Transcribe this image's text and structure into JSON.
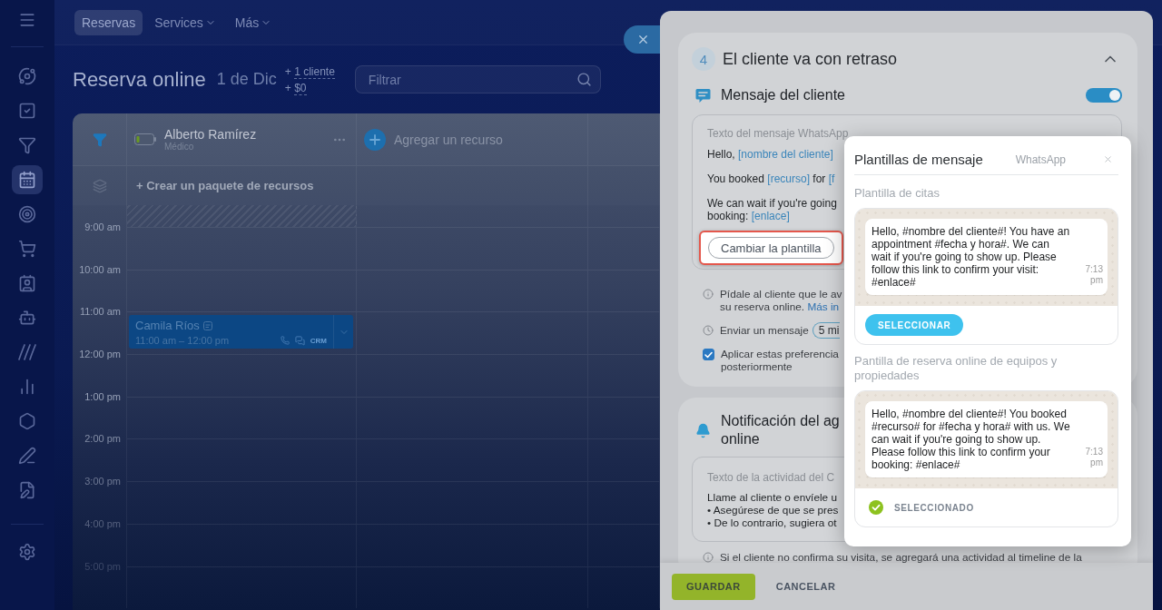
{
  "sidebar": {
    "items": [
      {
        "selected": false
      },
      {
        "selected": false
      },
      {
        "selected": false
      },
      {
        "selected": true
      },
      {
        "selected": false
      },
      {
        "selected": false
      },
      {
        "selected": false
      },
      {
        "selected": false
      },
      {
        "selected": false
      },
      {
        "selected": false
      },
      {
        "selected": false
      },
      {
        "selected": false
      },
      {
        "selected": false
      },
      {
        "selected": false
      }
    ]
  },
  "top_nav": {
    "tabs": [
      {
        "label": "Reservas",
        "selected": true,
        "dropdown": false
      },
      {
        "label": "Services",
        "selected": false,
        "dropdown": true
      },
      {
        "label": "Más",
        "selected": false,
        "dropdown": true
      }
    ]
  },
  "header": {
    "title": "Reserva online",
    "date": "1 de Dic",
    "stats": [
      {
        "sign": "+",
        "value": "1 cliente"
      },
      {
        "sign": "+",
        "value": "$0"
      }
    ],
    "search": {
      "placeholder": "Filtrar"
    }
  },
  "calendar": {
    "resource": {
      "name": "Alberto Ramírez",
      "role": "Médico"
    },
    "add_resource": "Agregar un recurso",
    "create_package": "+ Crear un paquete de recursos",
    "hours": [
      {
        "label": "9:00 am"
      },
      {
        "label": "10:00 am"
      },
      {
        "label": "11:00 am",
        "bookings": [
          {
            "name": "Camila Ríos",
            "time": "11:00 am – 12:00 pm",
            "tag": "CRM"
          }
        ]
      },
      {
        "label": "12:00 pm"
      },
      {
        "label": "1:00 pm"
      },
      {
        "label": "2:00 pm"
      },
      {
        "label": "3:00 pm"
      },
      {
        "label": "4:00 pm"
      },
      {
        "label": "5:00 pm"
      }
    ]
  },
  "panel": {
    "step": {
      "number": "4",
      "title": "El cliente va con retraso",
      "expanded": true
    },
    "client_message": {
      "title": "Mensaje del cliente",
      "enabled": true,
      "message_box": {
        "label": "Texto del mensaje WhatsApp",
        "paragraphs": [
          {
            "lines": [
              {
                "segments": [
                  {
                    "kind": "plain",
                    "text": "Hello, "
                  },
                  {
                    "kind": "token",
                    "text": "[nombre del cliente]"
                  }
                ]
              }
            ]
          },
          {
            "lines": [
              {
                "segments": [
                  {
                    "kind": "plain",
                    "text": "You booked "
                  },
                  {
                    "kind": "token",
                    "text": "[recurso]"
                  },
                  {
                    "kind": "plain",
                    "text": " for "
                  },
                  {
                    "kind": "token",
                    "text": "[f"
                  }
                ]
              }
            ]
          },
          {
            "lines": [
              {
                "segments": [
                  {
                    "kind": "plain",
                    "text": "We can wait if you're going"
                  }
                ]
              },
              {
                "segments": [
                  {
                    "kind": "plain",
                    "text": "booking: "
                  },
                  {
                    "kind": "token",
                    "text": "[enlace]"
                  }
                ]
              }
            ]
          }
        ]
      },
      "change_template": {
        "label": "Cambiar la plantilla",
        "highlighted": true
      },
      "notes": [
        {
          "kind": "info",
          "lines": [
            {
              "segments": [
                {
                  "kind": "plain",
                  "text": "Pídale al cliente que le av"
                }
              ]
            },
            {
              "segments": [
                {
                  "kind": "plain",
                  "text": "su reserva online. "
                },
                {
                  "kind": "link",
                  "text": "Más in"
                }
              ]
            }
          ]
        },
        {
          "kind": "delay",
          "text": "Enviar un mensaje",
          "value": "5 mi"
        },
        {
          "kind": "checkbox",
          "checked": true,
          "lines": [
            "Aplicar estas preferencia",
            "posteriormente"
          ]
        }
      ]
    },
    "notification": {
      "title_lines": [
        "Notificación del ag",
        "online"
      ],
      "activity_box": {
        "label": "Texto de la actividad del C",
        "lines": [
          "Llame al cliente o envíele u",
          "• Asegúrese de que se pres",
          "• De lo contrario, sugiera ot"
        ]
      },
      "note": "Si el cliente no confirma su visita, se agregará una actividad al timeline de la"
    },
    "footer": {
      "buttons": [
        {
          "kind": "primary",
          "label": "GUARDAR"
        },
        {
          "kind": "secondary",
          "label": "CANCELAR"
        }
      ]
    }
  },
  "template_dialog": {
    "title": "Plantillas de mensaje",
    "channel": "WhatsApp",
    "templates": [
      {
        "title": "Plantilla de citas",
        "message": "Hello, #nombre del cliente#! You have an appointment #fecha y hora#. We can wait if you're going to show up. Please follow this link to confirm your visit: #enlace#",
        "time": "7:13 pm",
        "selected": false,
        "action": "SELECCIONAR"
      },
      {
        "title": "Pantilla de reserva online de equipos y propiedades",
        "message": "Hello, #nombre del cliente#! You booked #recurso# for #fecha y hora# with us. We can wait if you're going to show up. Please follow this link to confirm your booking: #enlace#",
        "time": "7:13 pm",
        "selected": true,
        "action": "SELECCIONADO"
      }
    ]
  }
}
